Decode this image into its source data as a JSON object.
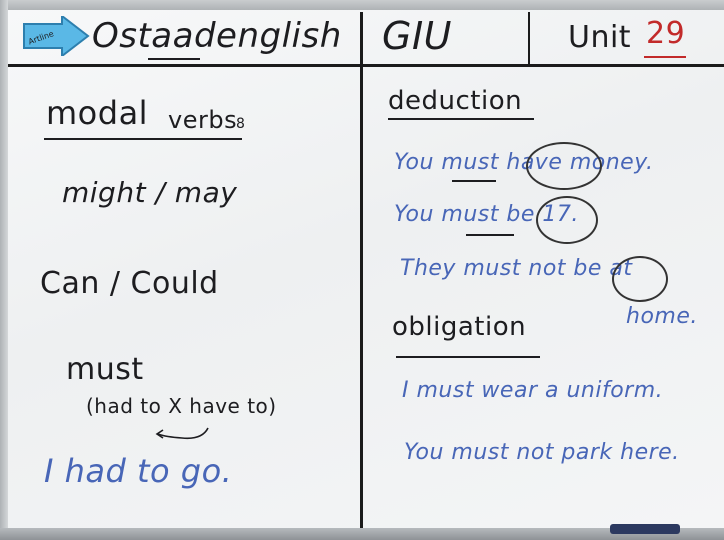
{
  "header": {
    "magnet_text": "Artline",
    "brand": "Ostaadenglish",
    "school": "GIU",
    "unit_label": "Unit",
    "unit_number": "29"
  },
  "left": {
    "title_a": "modal",
    "title_b": "verbs",
    "title_mark": "8",
    "item1": "might / may",
    "item2": "Can / Could",
    "item3": "must",
    "item3_note": "(had to X have to)",
    "example": "I had to go."
  },
  "right": {
    "section1": "deduction",
    "line1": "You must have money.",
    "line2": "You must be 17.",
    "line3a": "They must not be at",
    "line3b": "home.",
    "section2": "obligation",
    "line4": "I must wear a uniform.",
    "line5": "You must not park here."
  },
  "colors": {
    "marker_black": "#1d1d20",
    "marker_blue": "#4866b7",
    "marker_red": "#c22a2a",
    "magnet_blue": "#5ab8e6"
  }
}
